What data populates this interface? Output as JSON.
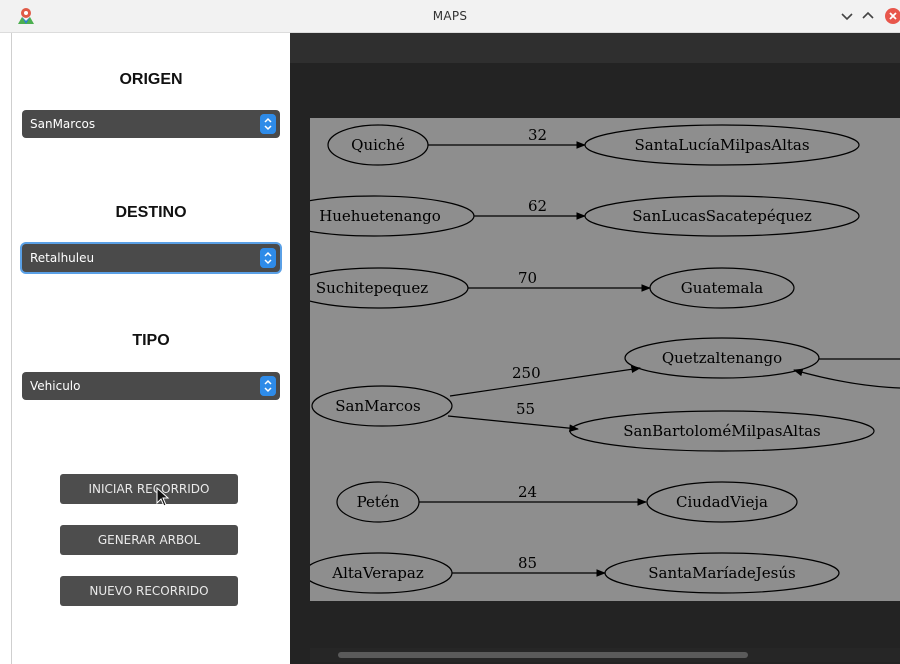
{
  "window": {
    "title": "MAPS"
  },
  "left_panel": {
    "origin": {
      "label": "ORIGEN",
      "value": "SanMarcos"
    },
    "destination": {
      "label": "DESTINO",
      "value": "Retalhuleu"
    },
    "type": {
      "label": "TIPO",
      "value": "Vehiculo"
    },
    "buttons": {
      "start": "INICIAR RECORRIDO",
      "generate": "GENERAR ARBOL",
      "new": "NUEVO RECORRIDO"
    }
  },
  "graph": {
    "nodes": [
      "Quiché",
      "SantaLucíaMilpasAltas",
      "Huehuetenango",
      "SanLucasSacatepéquez",
      "Suchitepequez",
      "Guatemala",
      "Quetzaltenango",
      "SanMarcos",
      "SanBartoloméMilpasAltas",
      "Petén",
      "CiudadVieja",
      "AltaVerapaz",
      "SantaMaríadeJesús"
    ],
    "edges": [
      {
        "from": "Quiché",
        "to": "SantaLucíaMilpasAltas",
        "weight": "32"
      },
      {
        "from": "Huehuetenango",
        "to": "SanLucasSacatepéquez",
        "weight": "62"
      },
      {
        "from": "Suchitepequez",
        "to": "Guatemala",
        "weight": "70"
      },
      {
        "from": "SanMarcos",
        "to": "Quetzaltenango",
        "weight": "250"
      },
      {
        "from": "SanMarcos",
        "to": "SanBartoloméMilpasAltas",
        "weight": "55"
      },
      {
        "from": "Petén",
        "to": "CiudadVieja",
        "weight": "24"
      },
      {
        "from": "AltaVerapaz",
        "to": "SantaMaríadeJesús",
        "weight": "85"
      }
    ]
  },
  "colors": {
    "select_bg": "#4a4a4a",
    "spinner": "#2e8be8",
    "focus_ring": "#5aa0e6",
    "close_button": "#e8564b",
    "graph_bg": "#8e8e8e"
  },
  "icons": {
    "app": "map-pin-icon",
    "minimize": "chevron-down-icon",
    "maximize": "chevron-up-icon",
    "close": "close-icon"
  }
}
